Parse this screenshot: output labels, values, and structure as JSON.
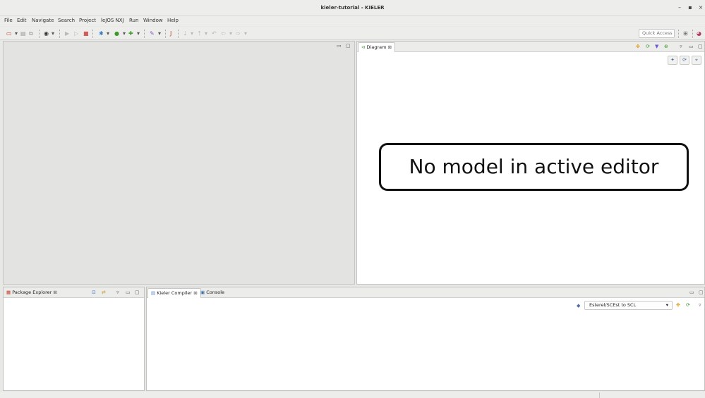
{
  "window": {
    "title": "kieler-tutorial - KIELER",
    "controls": [
      "–",
      "▪",
      "×"
    ]
  },
  "menubar": {
    "items": [
      "File",
      "Edit",
      "Navigate",
      "Search",
      "Project",
      "leJOS NXJ",
      "Run",
      "Window",
      "Help"
    ]
  },
  "toolbar": {
    "quick_access_placeholder": "Quick Access"
  },
  "editor": {
    "minimize": "▭",
    "maximize": "▢"
  },
  "diagram": {
    "tab_label": "Diagram",
    "close_glyph": "⊠",
    "message": "No model in active editor",
    "actions": [
      "✦",
      "⟳",
      "⌖"
    ]
  },
  "package_explorer": {
    "tab_label": "Package Explorer",
    "close_glyph": "⊠"
  },
  "compiler": {
    "tab_label": "Kieler Compiler",
    "close_glyph": "⊠",
    "console_tab_label": "Console",
    "transformation": "Esterel/SCEst to SCL"
  },
  "colors": {
    "chrome": "#ededec",
    "editor_bg": "#e3e3e2",
    "accent_green": "#3c9a2a",
    "accent_red": "#c0392b"
  }
}
